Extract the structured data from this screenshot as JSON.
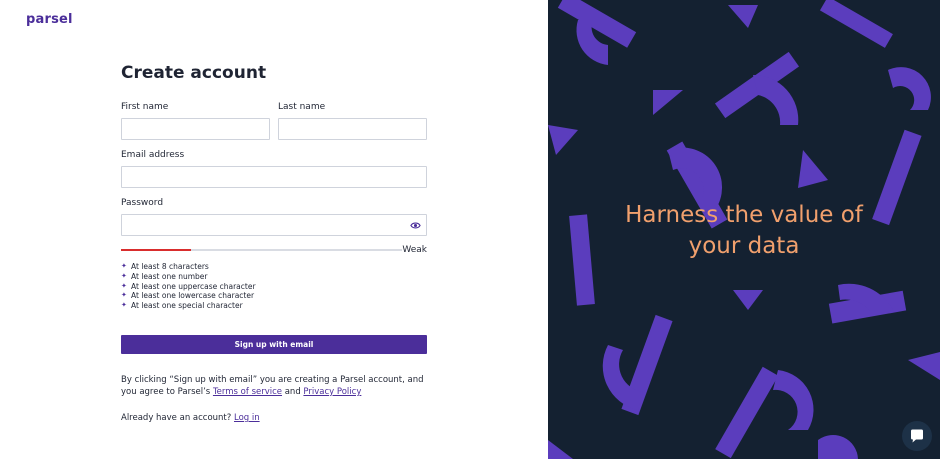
{
  "brand": {
    "logo_text": "parsel"
  },
  "form": {
    "title": "Create account",
    "first_name_label": "First name",
    "first_name_value": "",
    "last_name_label": "Last name",
    "last_name_value": "",
    "email_label": "Email address",
    "email_value": "",
    "password_label": "Password",
    "password_value": "",
    "password_strength": {
      "label": "Weak",
      "fraction": 0.25,
      "color": "#d92d2d"
    },
    "requirements": [
      "At least 8 characters",
      "At least one number",
      "At least one uppercase character",
      "At least one lowercase character",
      "At least one special character"
    ],
    "submit_label": "Sign up with email",
    "terms_prefix": "By clicking “Sign up with email” you are creating a Parsel account, and you agree to Parsel’s",
    "terms_link": "Terms of service",
    "terms_and": "and",
    "privacy_link": "Privacy Policy",
    "login_prompt": "Already have an account?",
    "login_link": "Log in"
  },
  "hero": {
    "line1": "Harness the value of",
    "line2": "your data"
  },
  "icons": {
    "password_toggle": "eye-icon",
    "requirement_bullet": "sparkle-icon",
    "chat": "chat-bubble-icon"
  },
  "colors": {
    "brand_purple": "#4b2e9a",
    "hero_background": "#142131",
    "hero_text": "#f1a06d",
    "shape_purple": "#5b3dbd",
    "weak_red": "#d92d2d"
  }
}
